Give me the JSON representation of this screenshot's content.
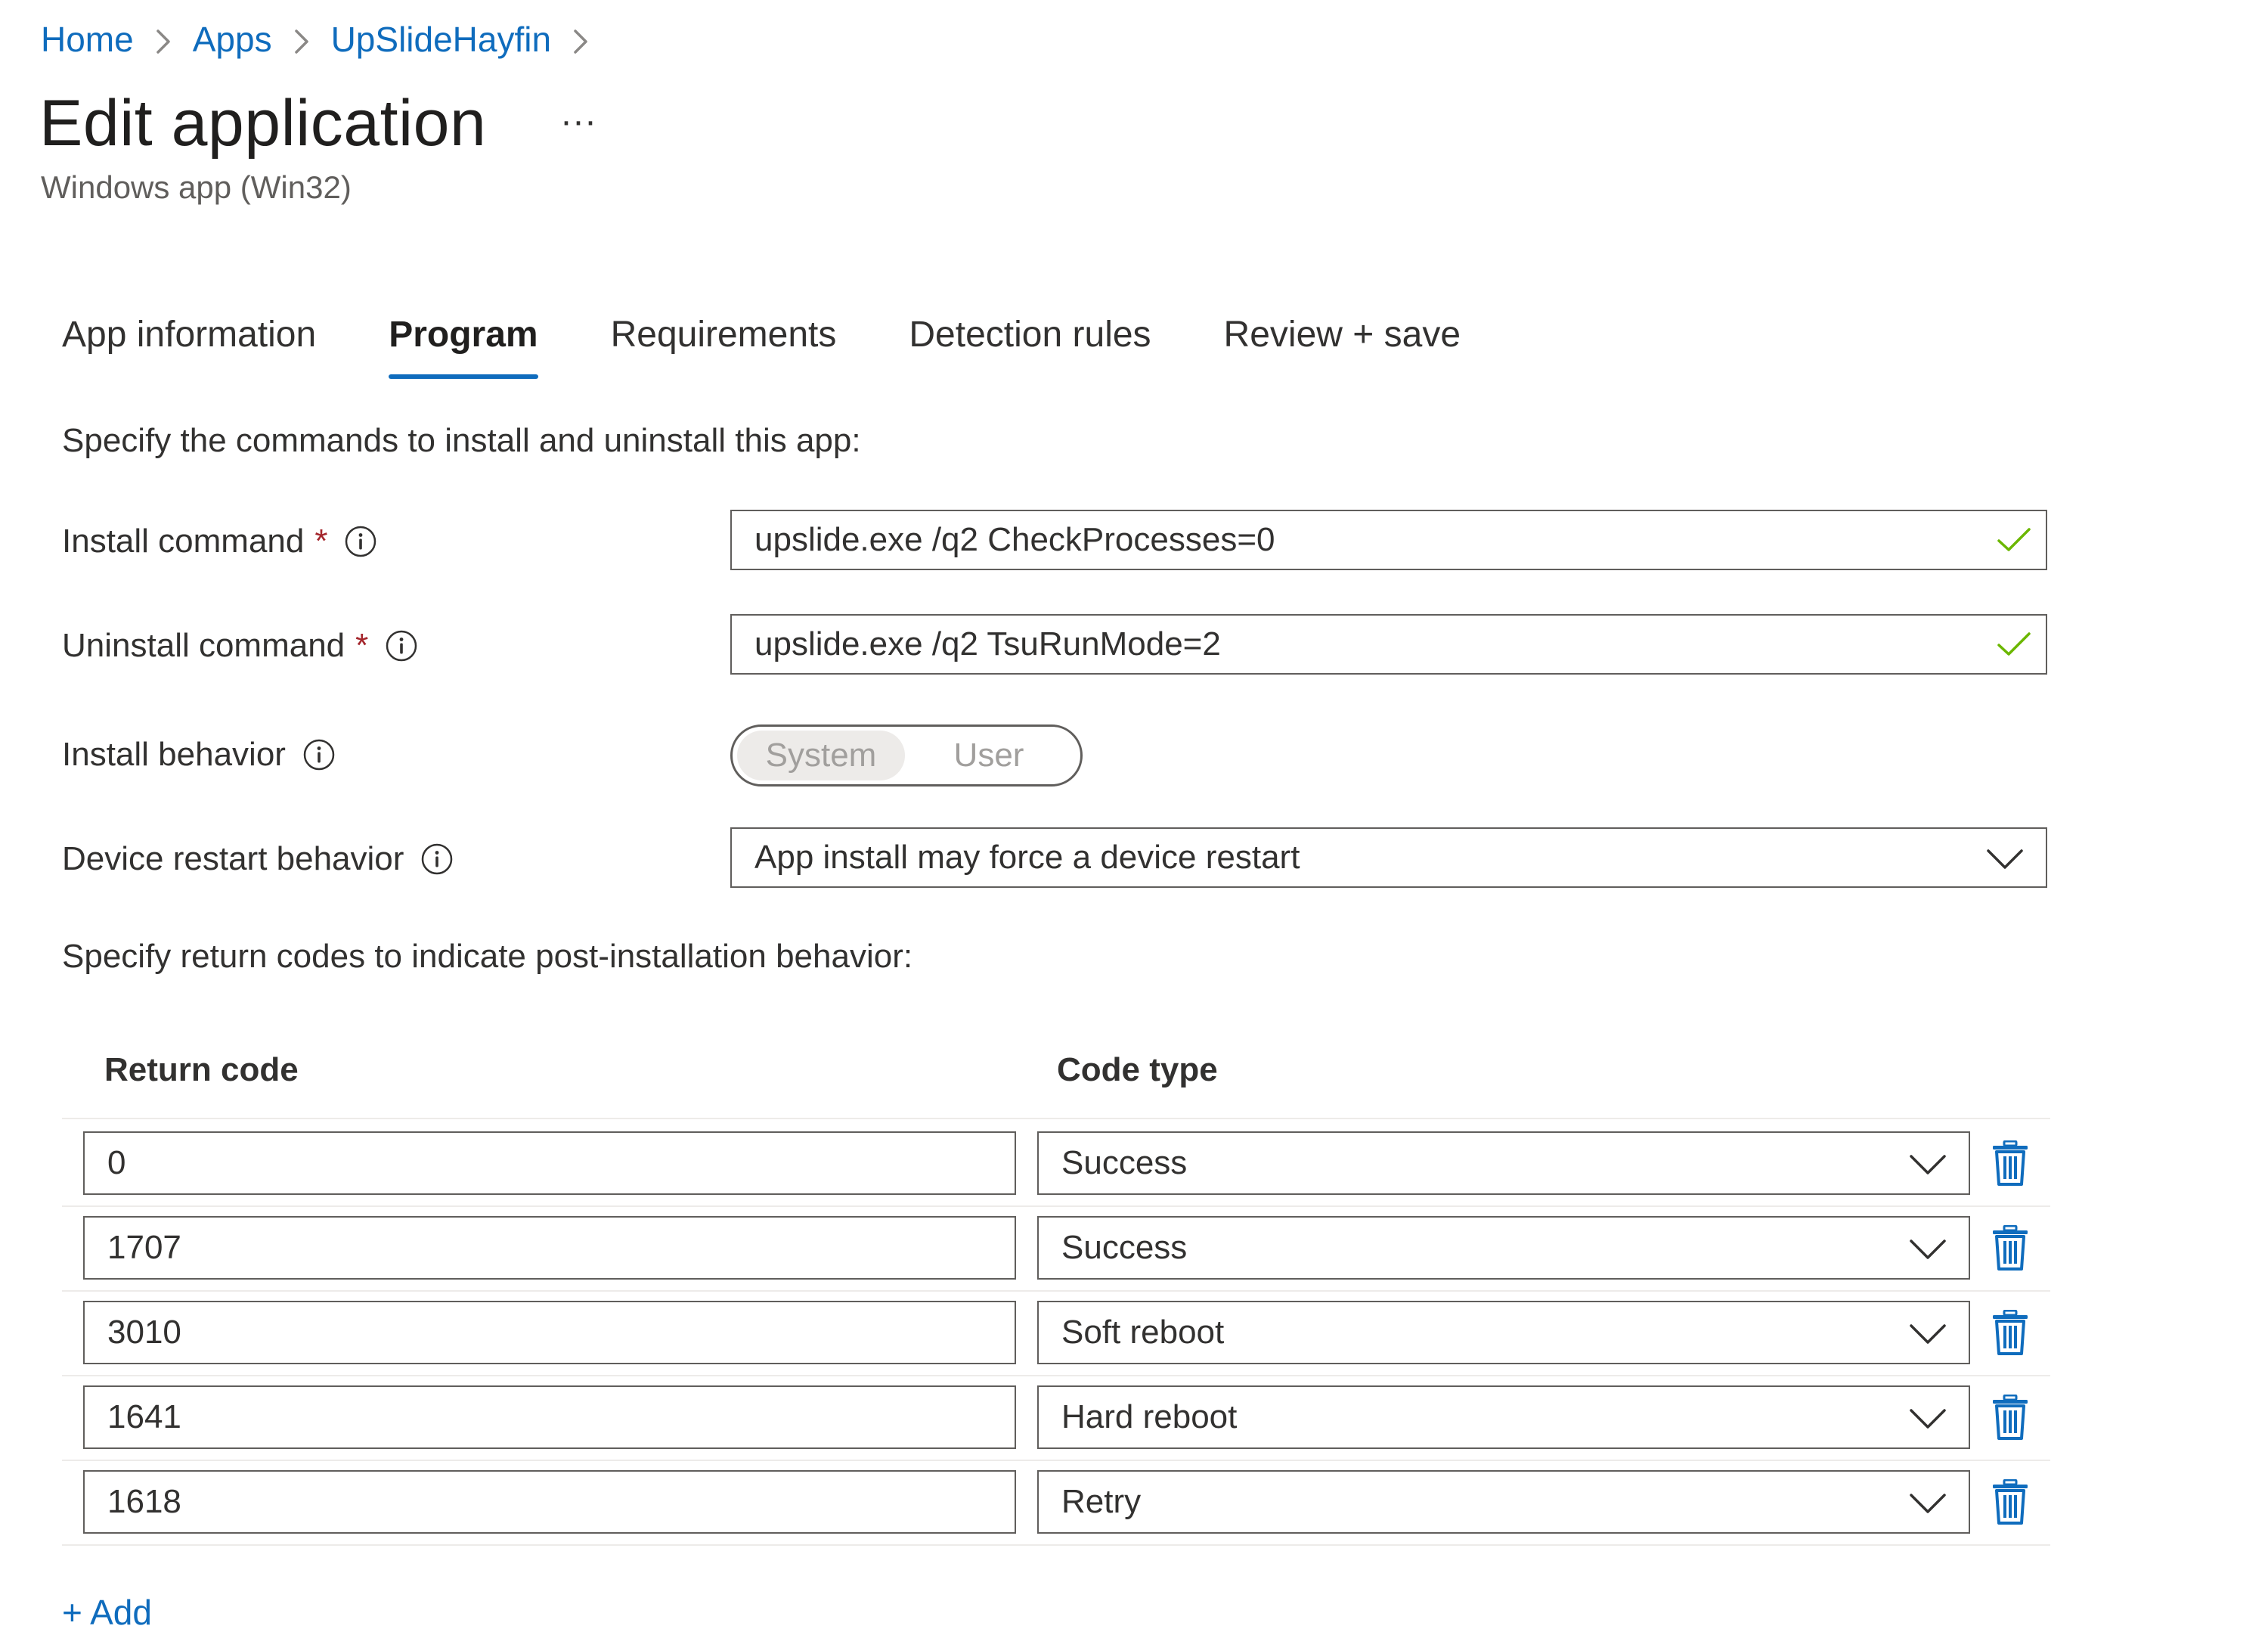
{
  "breadcrumb": {
    "items": [
      "Home",
      "Apps",
      "UpSlideHayfin"
    ]
  },
  "header": {
    "title": "Edit application",
    "more_label": "···",
    "subtitle": "Windows app (Win32)"
  },
  "tabs": [
    {
      "label": "App information",
      "active": false
    },
    {
      "label": "Program",
      "active": true
    },
    {
      "label": "Requirements",
      "active": false
    },
    {
      "label": "Detection rules",
      "active": false
    },
    {
      "label": "Review + save",
      "active": false
    }
  ],
  "program": {
    "commands_intro": "Specify the commands to install and uninstall this app:",
    "install_command": {
      "label": "Install command",
      "required": "*",
      "value": "upslide.exe /q2 CheckProcesses=0"
    },
    "uninstall_command": {
      "label": "Uninstall command",
      "required": "*",
      "value": "upslide.exe /q2 TsuRunMode=2"
    },
    "install_behavior": {
      "label": "Install behavior",
      "options": [
        "System",
        "User"
      ],
      "selected": "System"
    },
    "restart_behavior": {
      "label": "Device restart behavior",
      "value": "App install may force a device restart"
    },
    "return_codes_intro": "Specify return codes to indicate post-installation behavior:",
    "return_codes": {
      "col_code": "Return code",
      "col_type": "Code type",
      "rows": [
        {
          "code": "0",
          "type": "Success"
        },
        {
          "code": "1707",
          "type": "Success"
        },
        {
          "code": "3010",
          "type": "Soft reboot"
        },
        {
          "code": "1641",
          "type": "Hard reboot"
        },
        {
          "code": "1618",
          "type": "Retry"
        }
      ]
    },
    "add_label": "+ Add"
  },
  "colors": {
    "accent": "#0f6cbd",
    "required": "#a4262c",
    "valid_check": "#6bb700",
    "border": "#605e5c",
    "trash": "#0f6cbd"
  },
  "icons": {
    "breadcrumb_separator": "chevron-right-icon",
    "info": "info-icon",
    "valid": "check-icon",
    "dropdown": "chevron-down-icon",
    "delete": "trash-icon"
  }
}
